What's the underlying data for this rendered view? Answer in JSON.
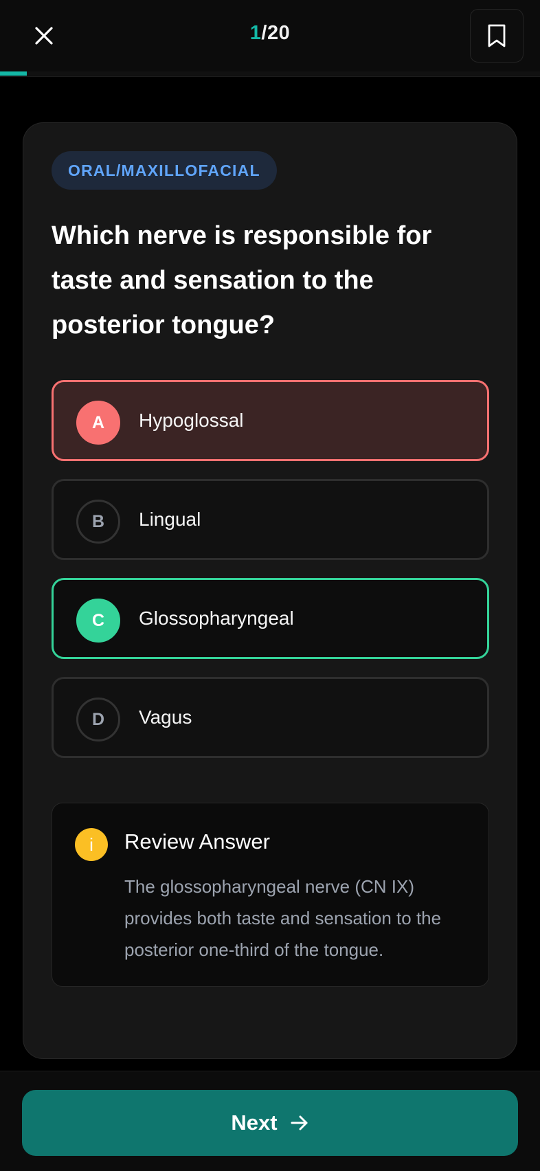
{
  "header": {
    "current": "1",
    "total": "/20",
    "progress_fraction": 0.05,
    "close_icon": "close-icon",
    "bookmark_icon": "bookmark-icon"
  },
  "question": {
    "category": "ORAL/MAXILLOFACIAL",
    "text": "Which nerve is responsible for taste and sensation to the posterior tongue?",
    "options": [
      {
        "letter": "A",
        "label": "Hypoglossal",
        "state": "wrong"
      },
      {
        "letter": "B",
        "label": "Lingual",
        "state": "neutral"
      },
      {
        "letter": "C",
        "label": "Glossopharyngeal",
        "state": "correct"
      },
      {
        "letter": "D",
        "label": "Vagus",
        "state": "neutral"
      }
    ]
  },
  "review": {
    "icon_glyph": "i",
    "title": "Review Answer",
    "text": "The glossopharyngeal nerve (CN IX) provides both taste and sensation to the posterior one-third of the tongue."
  },
  "footer": {
    "next_label": "Next",
    "next_icon": "arrow-right-icon"
  },
  "colors": {
    "accent": "#14b8a6",
    "button": "#0f766e",
    "wrong": "#f87171",
    "correct": "#34d399",
    "info": "#fbbf24",
    "tag_text": "#60a5fa"
  }
}
